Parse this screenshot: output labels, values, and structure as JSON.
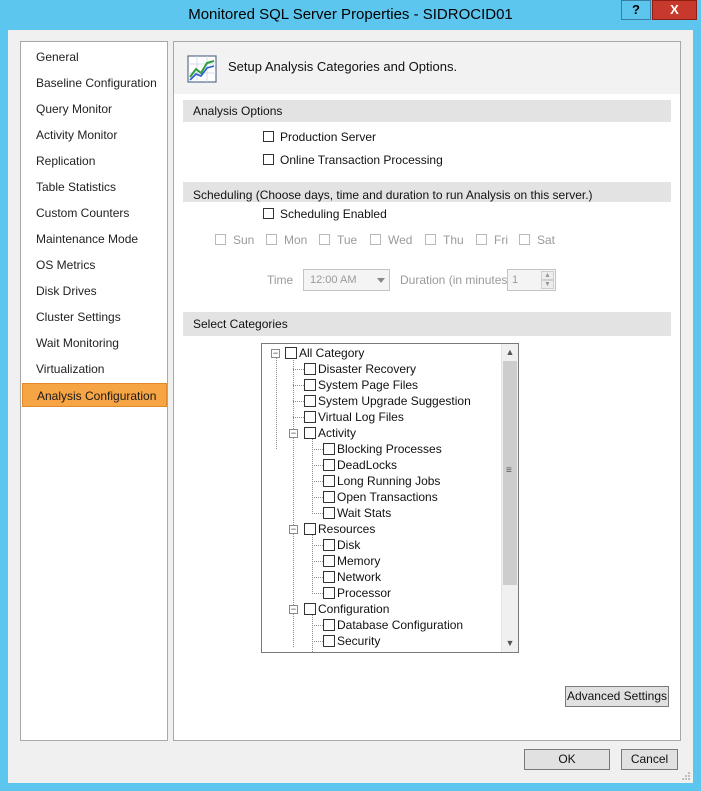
{
  "window": {
    "title": "Monitored SQL Server Properties - SIDROCID01",
    "help_label": "?",
    "close_label": "X"
  },
  "sidebar": {
    "items": [
      {
        "label": "General"
      },
      {
        "label": "Baseline Configuration"
      },
      {
        "label": "Query Monitor"
      },
      {
        "label": "Activity Monitor"
      },
      {
        "label": "Replication"
      },
      {
        "label": "Table Statistics"
      },
      {
        "label": "Custom Counters"
      },
      {
        "label": "Maintenance Mode"
      },
      {
        "label": "OS Metrics"
      },
      {
        "label": "Disk Drives"
      },
      {
        "label": "Cluster Settings"
      },
      {
        "label": "Wait Monitoring"
      },
      {
        "label": "Virtualization"
      },
      {
        "label": "Analysis Configuration",
        "active": true
      }
    ]
  },
  "panel": {
    "header": "Setup Analysis Categories and Options.",
    "analysis_options": {
      "title": "Analysis Options",
      "production_server": "Production Server",
      "oltp": "Online Transaction Processing"
    },
    "scheduling": {
      "title": "Scheduling (Choose days, time and duration to run Analysis on this server.)",
      "enabled_label": "Scheduling Enabled",
      "days": [
        "Sun",
        "Mon",
        "Tue",
        "Wed",
        "Thu",
        "Fri",
        "Sat"
      ],
      "time_label": "Time",
      "time_value": "12:00 AM",
      "duration_label": "Duration (in minutes)",
      "duration_value": "1"
    },
    "categories": {
      "title": "Select Categories",
      "tree": {
        "all": "All Category",
        "disaster_recovery": "Disaster Recovery",
        "system_page_files": "System Page Files",
        "system_upgrade": "System Upgrade Suggestion",
        "virtual_log_files": "Virtual Log Files",
        "activity": "Activity",
        "blocking": "Blocking Processes",
        "deadlocks": "DeadLocks",
        "long_running": "Long Running Jobs",
        "open_transactions": "Open Transactions",
        "wait_stats": "Wait Stats",
        "resources": "Resources",
        "disk": "Disk",
        "memory": "Memory",
        "network": "Network",
        "processor": "Processor",
        "configuration": "Configuration",
        "database_configuration": "Database Configuration",
        "security": "Security"
      }
    },
    "advanced_settings": "Advanced Settings"
  },
  "footer": {
    "ok": "OK",
    "cancel": "Cancel"
  }
}
